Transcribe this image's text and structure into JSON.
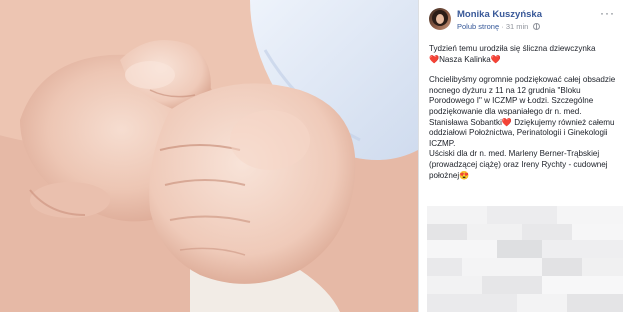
{
  "post": {
    "author": "Monika Kuszyńska",
    "like_page": "Polub stronę",
    "separator": "·",
    "time": "31 min",
    "more": "···",
    "lines": [
      "Tydzień temu urodziła się śliczna dziewczynka",
      "❤️Nasza Kalinka❤️",
      "Chcielibyśmy ogromnie podziękować całej obsadzie",
      "nocnego dyżuru z 11 na 12 grudnia \"Bloku",
      "Porodowego I\" w ICZMP w Łodzi. Szczególne",
      "podziękowanie dla wspaniałego dr n. med.",
      "Stanisława Sobantki❤️ Dziękujemy również całemu",
      "oddziałowi Położnictwa, Perinatologii i Ginekologii",
      "ICZMP.",
      "Uściski dla dr n. med. Marleny Berner-Trąbskiej",
      "(prowadzącej ciążę) oraz Ireny Rychty - cudownej",
      "położnej😍"
    ]
  },
  "colors": {
    "link": "#385898",
    "text": "#1d2129",
    "meta": "#90949c"
  }
}
